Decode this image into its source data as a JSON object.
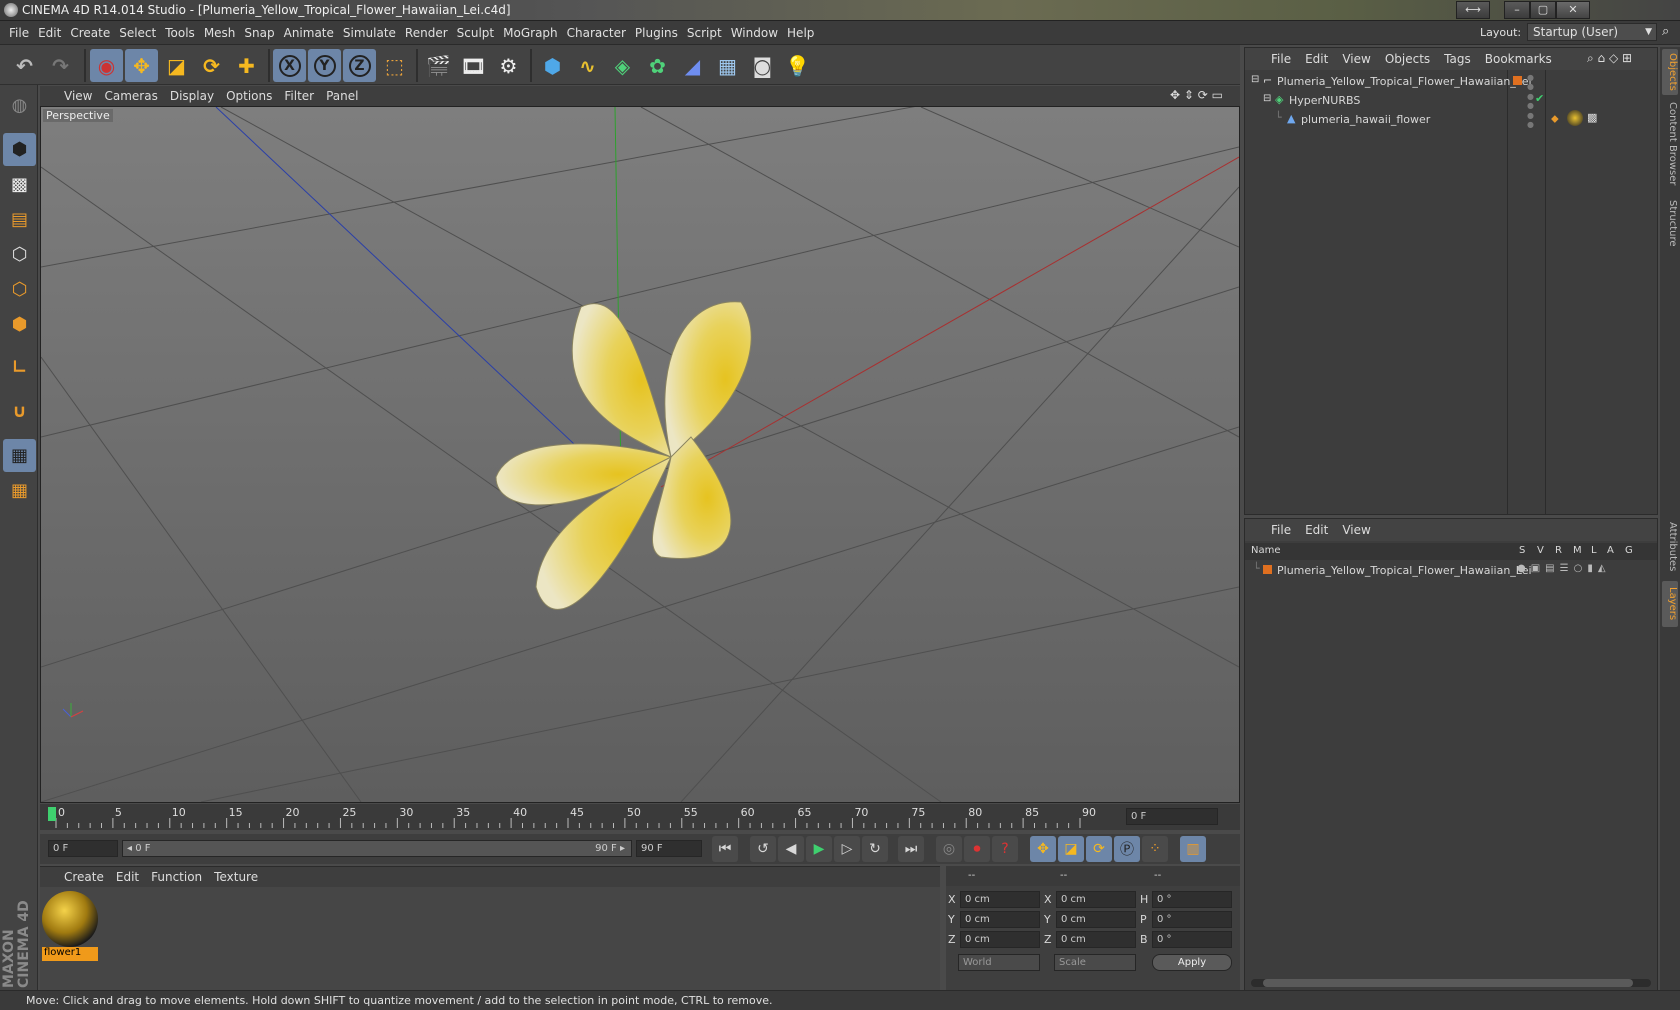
{
  "window": {
    "title": "CINEMA 4D R14.014 Studio - [Plumeria_Yellow_Tropical_Flower_Hawaiian_Lei.c4d]",
    "buttons": [
      "⟷",
      "–",
      "▢",
      "✕"
    ]
  },
  "menubar": {
    "items": [
      "File",
      "Edit",
      "Create",
      "Select",
      "Tools",
      "Mesh",
      "Snap",
      "Animate",
      "Simulate",
      "Render",
      "Sculpt",
      "MoGraph",
      "Character",
      "Plugins",
      "Script",
      "Window",
      "Help"
    ],
    "layout_label": "Layout:",
    "layout_value": "Startup (User)"
  },
  "toolbar": {
    "x_label": "X",
    "y_label": "Y",
    "z_label": "Z"
  },
  "viewport": {
    "menu": [
      "View",
      "Cameras",
      "Display",
      "Options",
      "Filter",
      "Panel"
    ],
    "label": "Perspective"
  },
  "timeline": {
    "ticks": [
      "0",
      "5",
      "10",
      "15",
      "20",
      "25",
      "30",
      "35",
      "40",
      "45",
      "50",
      "55",
      "60",
      "65",
      "70",
      "75",
      "80",
      "85",
      "90"
    ],
    "current_frame": "0 F",
    "start_field": "0 F",
    "range_start": "◂ 0 F",
    "range_end": "90 F ▸",
    "end_field": "90 F"
  },
  "material_manager": {
    "menu": [
      "Create",
      "Edit",
      "Function",
      "Texture"
    ],
    "materials": [
      {
        "name": "flower1"
      }
    ]
  },
  "coordinates": {
    "header": [
      "--",
      "--",
      "--"
    ],
    "rows": [
      {
        "l1": "X",
        "v1": "0 cm",
        "l2": "X",
        "v2": "0 cm",
        "l3": "H",
        "v3": "0 °"
      },
      {
        "l1": "Y",
        "v1": "0 cm",
        "l2": "Y",
        "v2": "0 cm",
        "l3": "P",
        "v3": "0 °"
      },
      {
        "l1": "Z",
        "v1": "0 cm",
        "l2": "Z",
        "v2": "0 cm",
        "l3": "B",
        "v3": "0 °"
      }
    ],
    "mode1": "World",
    "mode2": "Scale",
    "apply": "Apply"
  },
  "object_manager": {
    "menu": [
      "File",
      "Edit",
      "View",
      "Objects",
      "Tags",
      "Bookmarks"
    ],
    "objects": [
      {
        "name": "Plumeria_Yellow_Tropical_Flower_Hawaiian_Lei",
        "indent": 0
      },
      {
        "name": "HyperNURBS",
        "indent": 1
      },
      {
        "name": "plumeria_hawaii_flower",
        "indent": 2
      }
    ]
  },
  "layer_manager": {
    "menu": [
      "File",
      "Edit",
      "View"
    ],
    "columns": [
      "Name",
      "S",
      "V",
      "R",
      "M",
      "L",
      "A",
      "G"
    ],
    "layers": [
      {
        "name": "Plumeria_Yellow_Tropical_Flower_Hawaiian_Lei"
      }
    ]
  },
  "right_tabs": [
    "Objects",
    "Content Browser",
    "Structure",
    "Attributes",
    "Layers"
  ],
  "status": "Move: Click and drag to move elements. Hold down SHIFT to quantize movement / add to the selection in point mode, CTRL to remove.",
  "colors": {
    "accent": "#6d86a8",
    "layer_color": "#e07020",
    "material_label_bg": "#f09a1a"
  }
}
